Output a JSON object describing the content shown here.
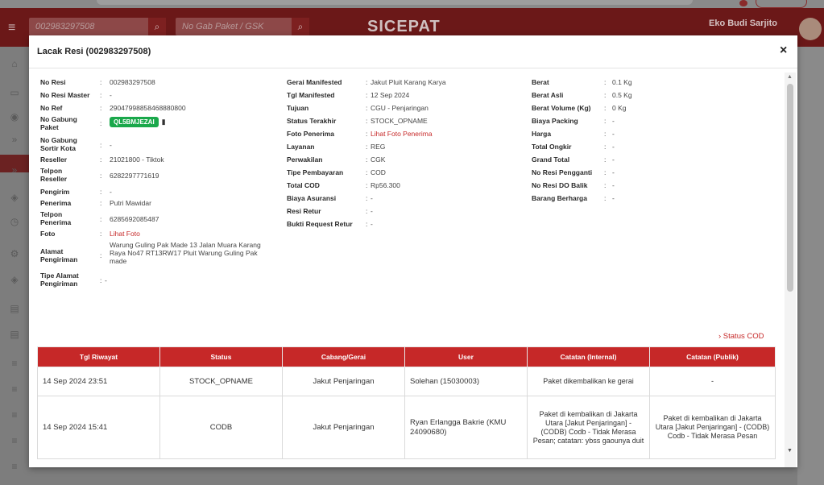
{
  "app": {
    "search_resi_value": "002983297508",
    "search_gabung_placeholder": "No Gab Paket / GSK",
    "logo": "SICEPAT",
    "user_name": "Eko Budi Sarjito"
  },
  "modal": {
    "title": "Lacak Resi (002983297508)",
    "close": "×",
    "col1": [
      {
        "key": "No Resi",
        "value": "002983297508"
      },
      {
        "key": "No Resi Master",
        "value": "-"
      },
      {
        "key": "No Ref",
        "value": "29047998858468880800"
      },
      {
        "key": "No Gabung Paket",
        "value": "QL5BMJEZAI"
      },
      {
        "key": "No Gabung Sortir Kota",
        "value": "-"
      },
      {
        "key": "Reseller",
        "value": "21021800 - Tiktok"
      },
      {
        "key": "Telpon Reseller",
        "value": "6282297771619"
      },
      {
        "key": "Pengirim",
        "value": "-"
      },
      {
        "key": "Penerima",
        "value": "Putri Mawidar"
      },
      {
        "key": "Telpon Penerima",
        "value": "6285692085487"
      },
      {
        "key": "Foto",
        "value": "Lihat Foto"
      },
      {
        "key": "Alamat Pengiriman",
        "value": "Warung Guling Pak Made 13 Jalan Muara Karang Raya No47 RT13RW17 Pluit Warung Guling Pak made"
      },
      {
        "key": "Tipe Alamat Pengiriman",
        "value": "-"
      }
    ],
    "col2": [
      {
        "key": "Gerai Manifested",
        "value": "Jakut Pluit Karang Karya"
      },
      {
        "key": "Tgl Manifested",
        "value": "12 Sep 2024"
      },
      {
        "key": "Tujuan",
        "value": "CGU - Penjaringan"
      },
      {
        "key": "Status Terakhir",
        "value": "STOCK_OPNAME"
      },
      {
        "key": "Foto Penerima",
        "value": "Lihat Foto Penerima"
      },
      {
        "key": "Layanan",
        "value": "REG"
      },
      {
        "key": "Perwakilan",
        "value": "CGK"
      },
      {
        "key": "Tipe Pembayaran",
        "value": "COD"
      },
      {
        "key": "Total COD",
        "value": "Rp56.300"
      },
      {
        "key": "Biaya Asuransi",
        "value": "-"
      },
      {
        "key": "Resi Retur",
        "value": "-"
      },
      {
        "key": "Bukti Request Retur",
        "value": "-"
      }
    ],
    "col3": [
      {
        "key": "Berat",
        "value": "0.1 Kg"
      },
      {
        "key": "Berat Asli",
        "value": "0.5 Kg"
      },
      {
        "key": "Berat Volume (Kg)",
        "value": "0 Kg"
      },
      {
        "key": "Biaya Packing",
        "value": "-"
      },
      {
        "key": "Harga",
        "value": "-"
      },
      {
        "key": "Total Ongkir",
        "value": "-"
      },
      {
        "key": "Grand Total",
        "value": "-"
      },
      {
        "key": "No Resi Pengganti",
        "value": "-"
      },
      {
        "key": "No Resi DO Balik",
        "value": "-"
      },
      {
        "key": "Barang Berharga",
        "value": "-"
      }
    ],
    "status_cod_link": "› Status COD",
    "table": {
      "headers": [
        "Tgl Riwayat",
        "Status",
        "Cabang/Gerai",
        "User",
        "Catatan (Internal)",
        "Catatan (Publik)"
      ],
      "rows": [
        {
          "tgl": "14 Sep 2024 23:51",
          "status": "STOCK_OPNAME",
          "cabang": "Jakut Penjaringan",
          "user": "Solehan (15030003)",
          "internal": "Paket dikembalikan ke gerai",
          "publik": "-"
        },
        {
          "tgl": "14 Sep 2024 15:41",
          "status": "CODB",
          "cabang": "Jakut Penjaringan",
          "user": "Ryan Erlangga Bakrie (KMU 24090680)",
          "internal": "Paket di kembalikan di Jakarta Utara [Jakut Penjaringan] - (CODB) Codb - Tidak Merasa Pesan; catatan: ybss gaounya duit",
          "publik": "Paket di kembalikan di Jakarta Utara [Jakut Penjaringan] - (CODB) Codb - Tidak Merasa Pesan"
        }
      ]
    }
  },
  "colors": {
    "brand": "#c62828",
    "badge": "#1aa84b"
  }
}
